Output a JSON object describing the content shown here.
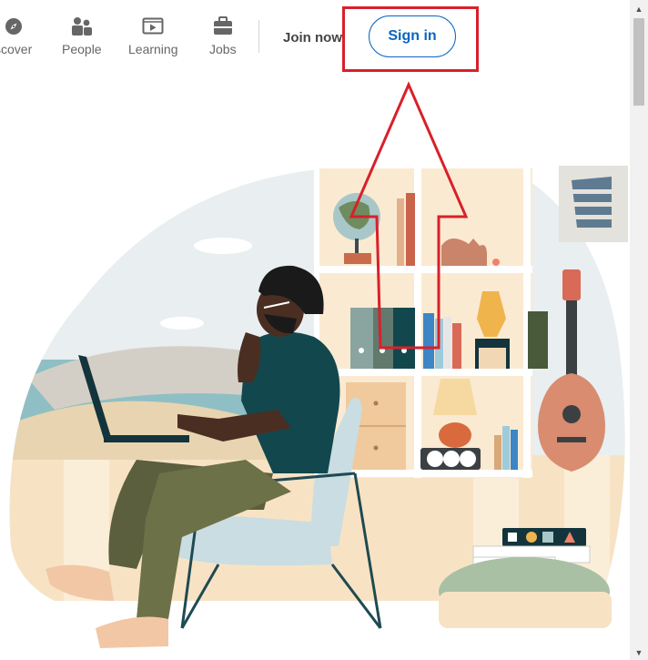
{
  "nav": {
    "items": [
      {
        "label": "scover",
        "icon": "compass-icon"
      },
      {
        "label": "People",
        "icon": "people-icon"
      },
      {
        "label": "Learning",
        "icon": "learning-icon"
      },
      {
        "label": "Jobs",
        "icon": "briefcase-icon"
      }
    ],
    "join_label": "Join now",
    "signin_label": "Sign in"
  },
  "annotation": {
    "highlight_color": "#d9202a",
    "arrow_color": "#d9202a"
  },
  "colors": {
    "brand_blue": "#0a66c2",
    "nav_text": "#666666"
  }
}
